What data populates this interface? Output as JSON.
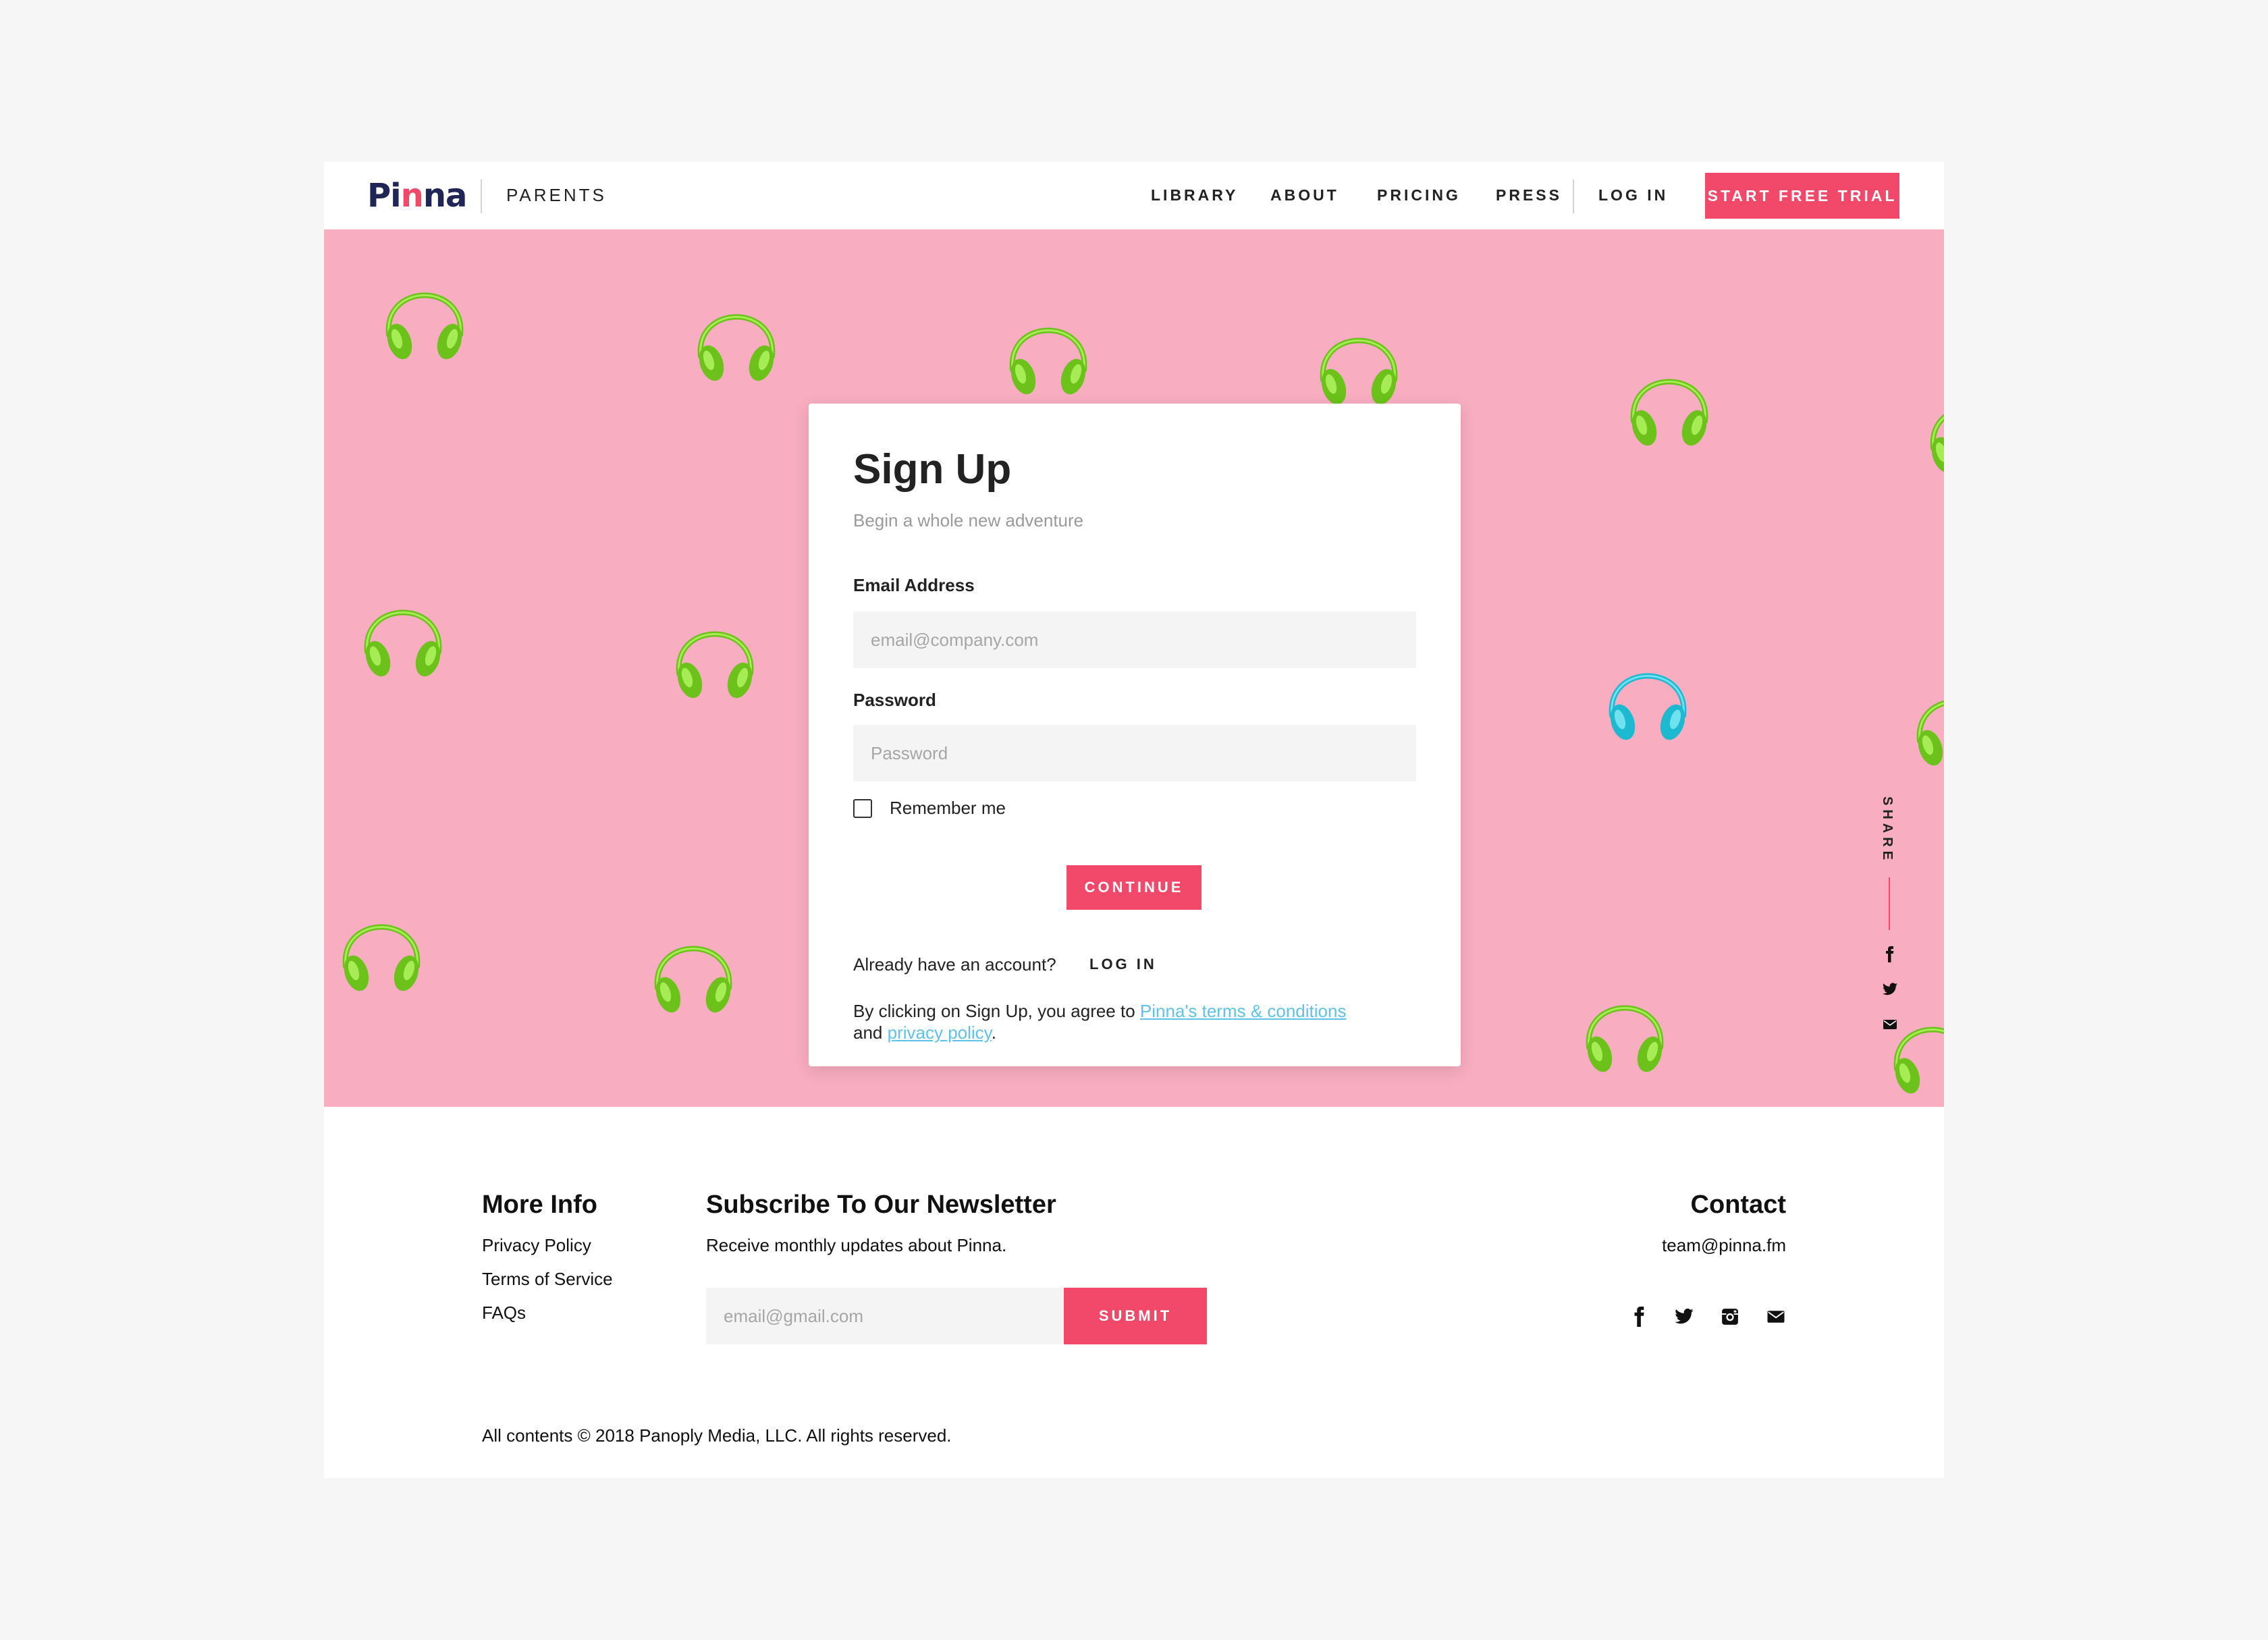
{
  "header": {
    "logo": {
      "prefix": "Pi",
      "mark": "n",
      "suffix": "na"
    },
    "section": "PARENTS",
    "nav": [
      "LIBRARY",
      "ABOUT",
      "PRICING",
      "PRESS"
    ],
    "login": "LOG IN",
    "cta": "START FREE TRIAL"
  },
  "signup": {
    "title": "Sign Up",
    "subtitle": "Begin a whole new adventure",
    "email_label": "Email Address",
    "email_placeholder": "email@company.com",
    "password_label": "Password",
    "password_placeholder": "Password",
    "remember_label": "Remember me",
    "remember_checked": false,
    "continue": "CONTINUE",
    "already": "Already have an account?",
    "login_link": "LOG IN",
    "terms_prefix": "By clicking on Sign Up, you agree to ",
    "terms_link": "Pinna's terms & conditions",
    "terms_and": "and ",
    "privacy_link": "privacy policy",
    "terms_end": "."
  },
  "share": {
    "label": "SHARE",
    "icons": [
      "facebook-icon",
      "twitter-icon",
      "mail-icon"
    ]
  },
  "hero": {
    "background": "#f8adc0",
    "headphone_color": "#7ed321",
    "accent_headphone_color": "#29c9de"
  },
  "footer": {
    "more_info": {
      "title": "More Info",
      "links": [
        "Privacy Policy",
        "Terms of Service",
        "FAQs"
      ]
    },
    "newsletter": {
      "title": "Subscribe To Our Newsletter",
      "subtitle": "Receive monthly updates about Pinna.",
      "placeholder": "email@gmail.com",
      "submit": "SUBMIT"
    },
    "contact": {
      "title": "Contact",
      "email": "team@pinna.fm",
      "icons": [
        "facebook-icon",
        "twitter-icon",
        "instagram-icon",
        "mail-icon"
      ]
    },
    "copyright": "All contents © 2018 Panoply Media, LLC. All rights reserved."
  },
  "colors": {
    "accent": "#f2486a",
    "brand": "#1f2555",
    "link": "#60c2e8"
  }
}
